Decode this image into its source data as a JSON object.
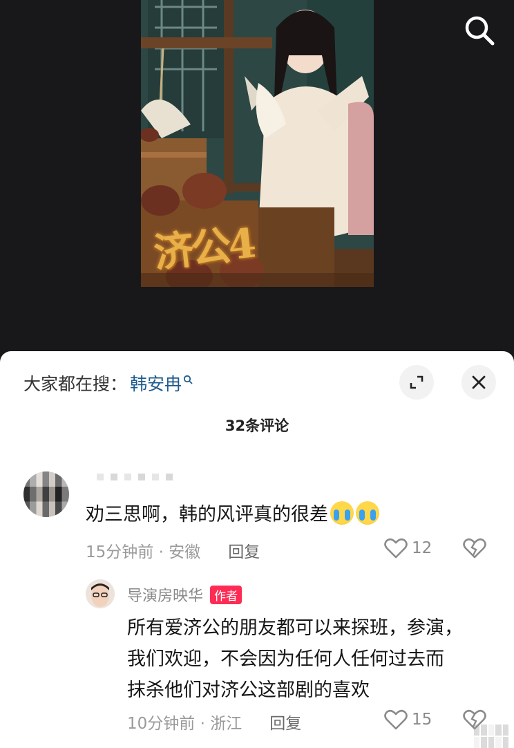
{
  "poster": {
    "title_art": "济公4"
  },
  "search_icon": "search-icon",
  "sheet": {
    "search_prefix": "大家都在搜：",
    "search_keyword": "韩安冉",
    "comment_count": "32条评论"
  },
  "comments": [
    {
      "text": "劝三思啊，韩的风评真的很差",
      "emoji": "crying-face-emoji",
      "time_location": "15分钟前 · 安徽",
      "reply_label": "回复",
      "likes": "12"
    }
  ],
  "reply": {
    "author": "导演房映华",
    "badge": "作者",
    "lines": [
      "所有爱济公的朋友都可以来探班，参演，",
      "我们欢迎，不会因为任何人任何过去而",
      "抹杀他们对济公这部剧的喜欢"
    ],
    "time_location": "10分钟前 · 浙江",
    "reply_label": "回复",
    "likes": "15"
  },
  "colors": {
    "keyword": "#1e5a8c",
    "badge": "#fe2c55",
    "meta": "#9a9a9a"
  }
}
